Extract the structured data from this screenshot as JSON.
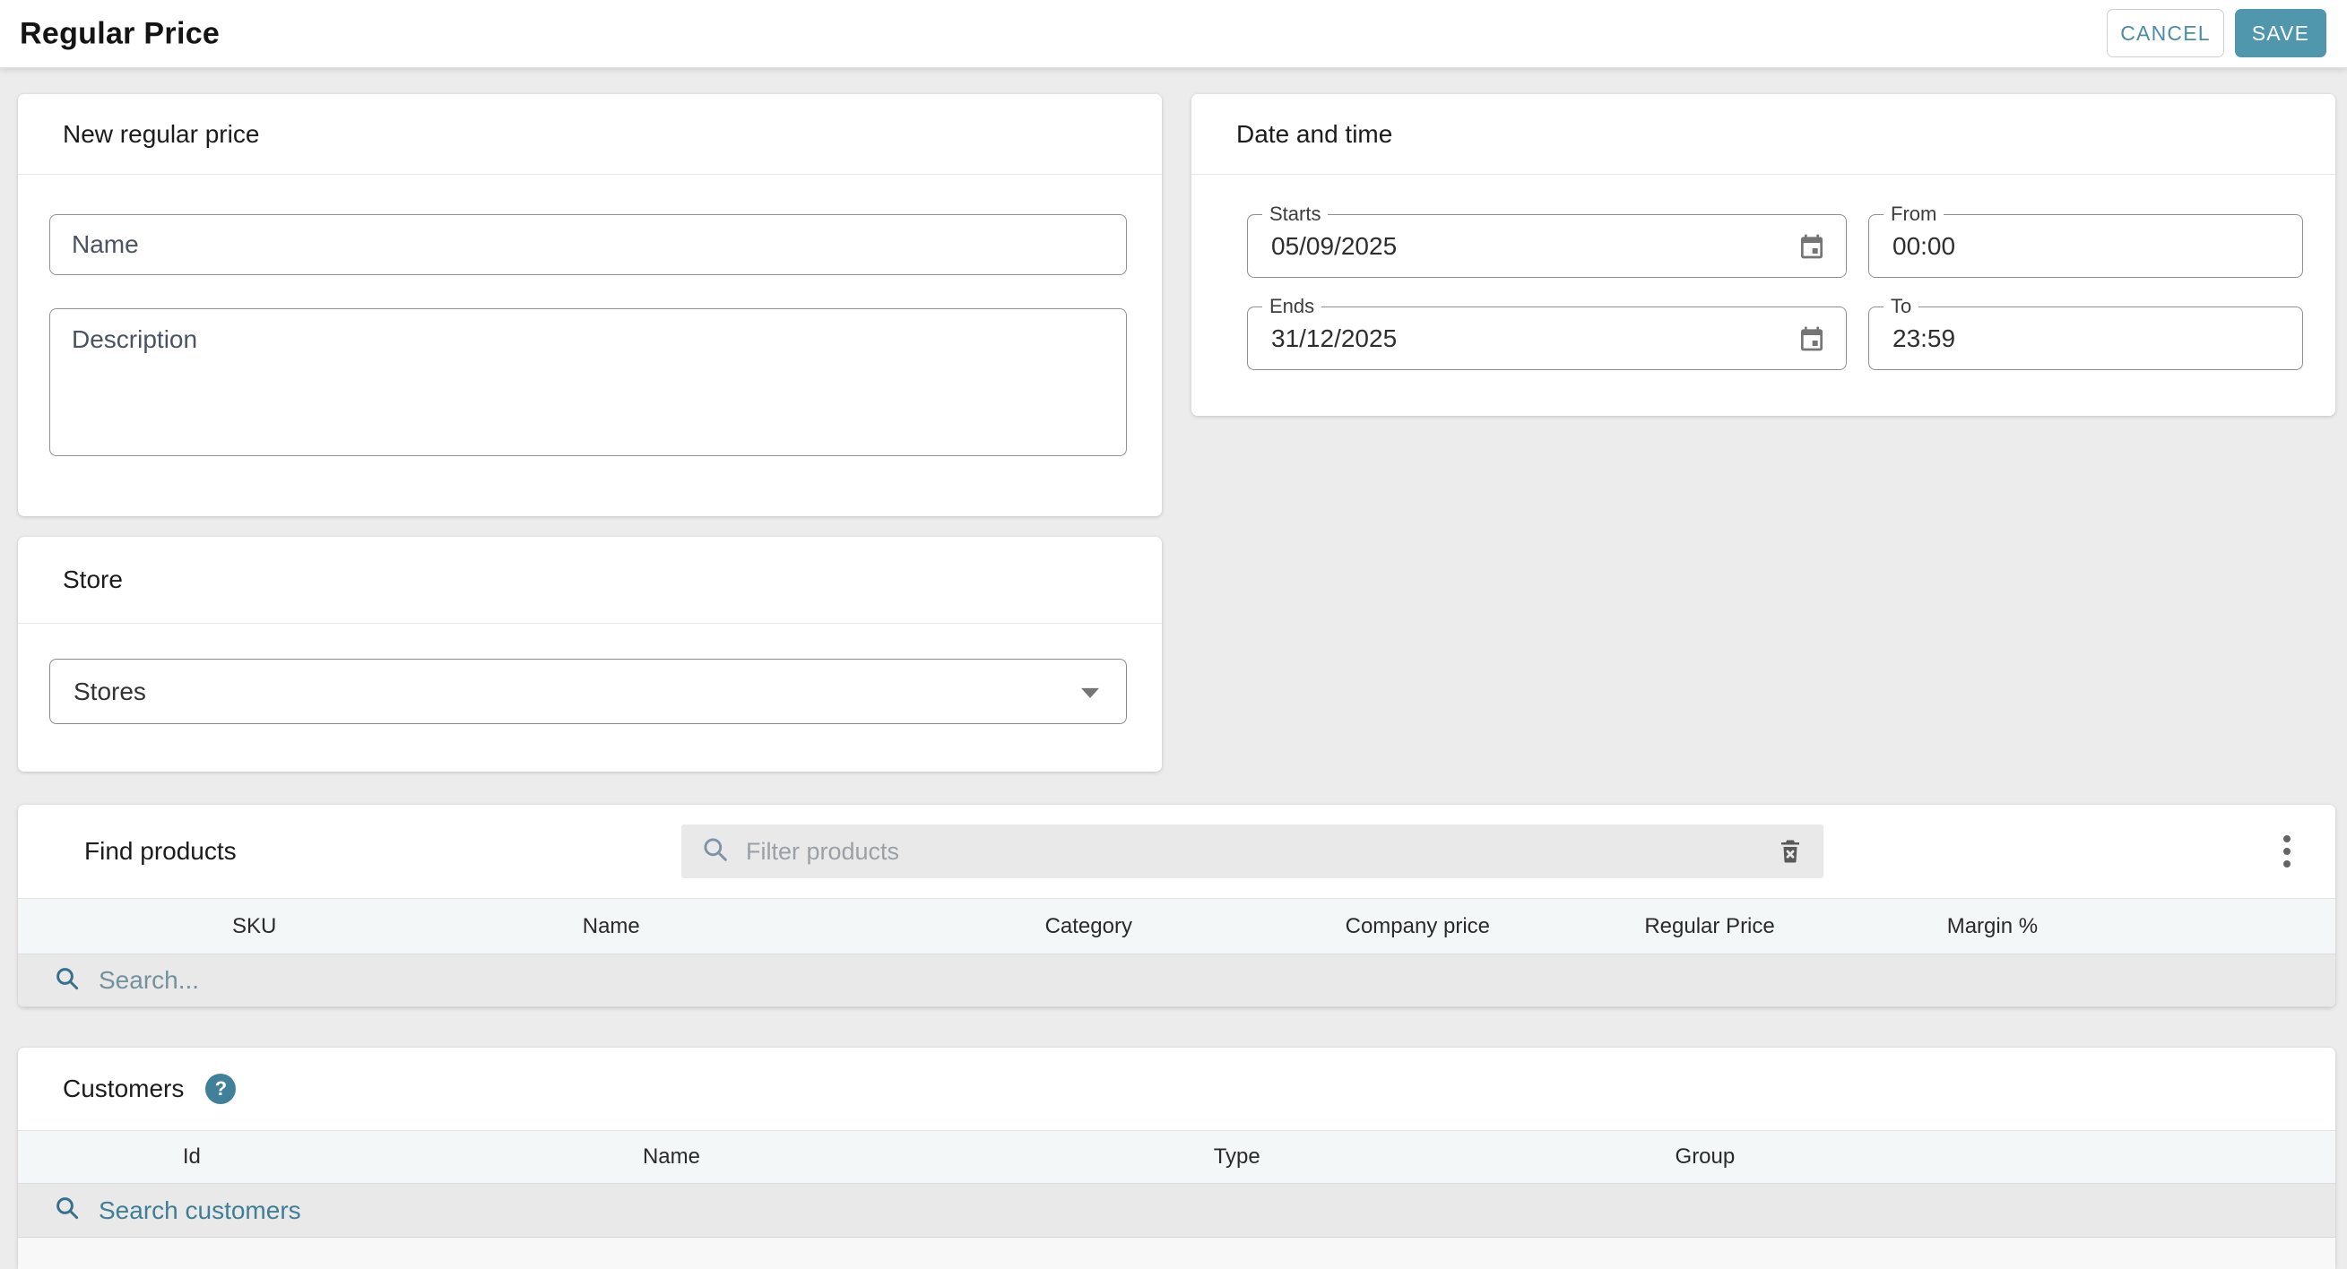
{
  "header": {
    "title": "Regular Price",
    "cancel_label": "CANCEL",
    "save_label": "SAVE"
  },
  "new_regular_price": {
    "title": "New regular price",
    "name_placeholder": "Name",
    "description_placeholder": "Description"
  },
  "date_and_time": {
    "title": "Date and time",
    "starts_label": "Starts",
    "starts_value": "05/09/2025",
    "from_label": "From",
    "from_value": "00:00",
    "ends_label": "Ends",
    "ends_value": "31/12/2025",
    "to_label": "To",
    "to_value": "23:59"
  },
  "store": {
    "title": "Store",
    "select_value": "Stores"
  },
  "find_products": {
    "title": "Find products",
    "filter_placeholder": "Filter products",
    "columns": [
      "SKU",
      "Name",
      "Category",
      "Company price",
      "Regular Price",
      "Margin %"
    ],
    "search_placeholder": "Search..."
  },
  "customers": {
    "title": "Customers",
    "help_label": "?",
    "columns": [
      "Id",
      "Name",
      "Type",
      "Group"
    ],
    "search_placeholder": "Search customers"
  },
  "colors": {
    "accent_teal": "#5096ad",
    "cancel_text": "#4a8da6",
    "page_bg": "#ececec",
    "table_header_bg": "#f3f7f8",
    "search_row_bg": "#e9e9e9"
  }
}
